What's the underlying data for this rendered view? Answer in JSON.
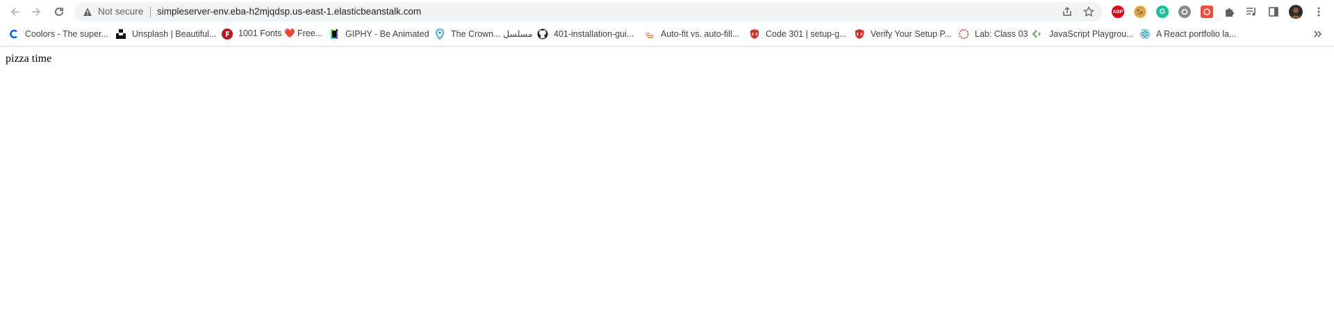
{
  "browser": {
    "security_label": "Not secure",
    "url": "simpleserver-env.eba-h2mjqdsp.us-east-1.elasticbeanstalk.com",
    "extensions": [
      {
        "icon": "adblock-icon",
        "text": "ABP",
        "color": "#e0001b"
      },
      {
        "icon": "cookie-icon",
        "color": "#c98a33"
      },
      {
        "icon": "grammarly-icon",
        "text": "G",
        "color": "#15c39a"
      },
      {
        "icon": "extension-gear-icon",
        "color": "#7a7a7a"
      },
      {
        "icon": "screen-recorder-icon",
        "color": "#f04e37"
      }
    ]
  },
  "bookmarks": [
    {
      "label": "Coolors - The super...",
      "icon": "coolors-icon",
      "color": "#0066ff"
    },
    {
      "label": "Unsplash | Beautiful...",
      "icon": "unsplash-icon",
      "color": "#111111"
    },
    {
      "label": "1001 Fonts ❤️ Free...",
      "icon": "fonts-icon",
      "color": "#c0141b"
    },
    {
      "label": "GIPHY - Be Animated",
      "icon": "giphy-icon",
      "color": "#000000"
    },
    {
      "label": "The Crown... مسلسل",
      "icon": "location-pin-icon",
      "color": "#19a0d8"
    },
    {
      "label": "401-installation-gui...",
      "icon": "github-icon",
      "color": "#24292f"
    },
    {
      "label": "Auto-fit vs. auto-fill...",
      "icon": "css-tricks-icon",
      "color": "#e8a23a"
    },
    {
      "label": "Code 301 | setup-g...",
      "icon": "codefellows-icon",
      "color": "#d0322b"
    },
    {
      "label": "Verify Your Setup P...",
      "icon": "codefellows-icon",
      "color": "#d0322b"
    },
    {
      "label": "Lab: Class 03",
      "icon": "canvas-icon",
      "color": "#e13f2b"
    },
    {
      "label": "JavaScript Playgrou...",
      "icon": "playground-icon",
      "color": "#5fa84a"
    },
    {
      "label": "A React portfolio la...",
      "icon": "react-icon",
      "color": "#3fa0c9"
    }
  ],
  "page": {
    "text": "pizza time"
  }
}
